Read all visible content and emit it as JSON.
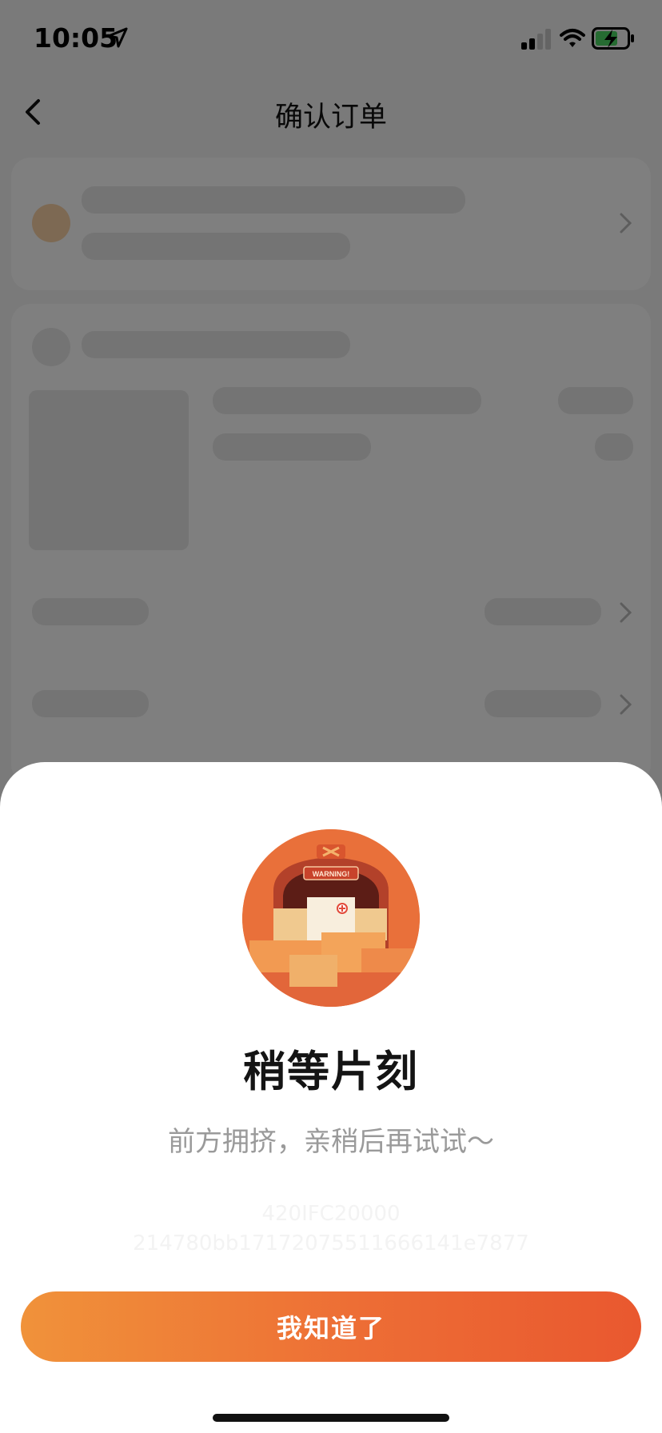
{
  "status_bar": {
    "time": "10:05",
    "icons": [
      "location-arrow-icon",
      "cellular-signal-icon",
      "wifi-icon",
      "battery-charging-icon"
    ]
  },
  "nav": {
    "title": "确认订单",
    "back_icon": "chevron-left-icon"
  },
  "dialog": {
    "illustration_icon": "warning-truck-illustration",
    "illustration_sign_text": "WARNING!",
    "title": "稍等片刻",
    "subtitle": "前方拥挤，亲稍后再试试～",
    "code_line1": "420IFC20000",
    "code_line2": "214780bb17172075511666141e7877",
    "button_label": "我知道了"
  },
  "colors": {
    "accent_start": "#f0923a",
    "accent_end": "#e9582f",
    "overlay": "rgba(0,0,0,0.5)"
  }
}
